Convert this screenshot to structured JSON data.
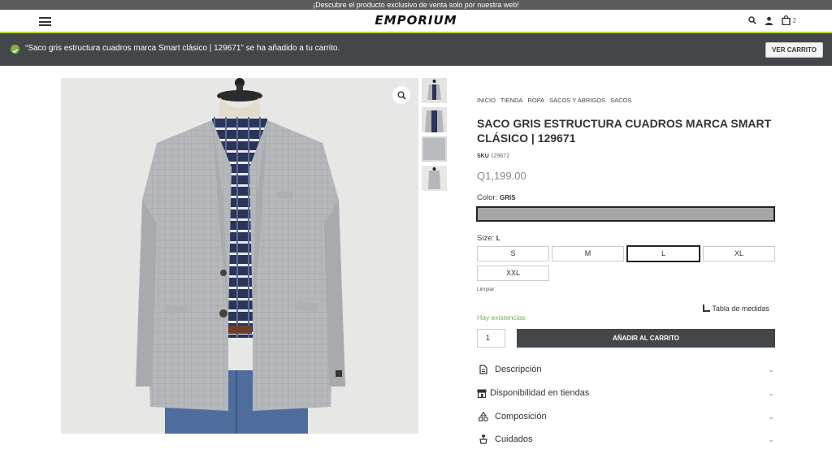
{
  "topbar": {
    "text": "¡Descubre el producto exclusivo de venta solo por nuestra web!"
  },
  "header": {
    "logo": "EMPORIUM",
    "cart_count": "2"
  },
  "notice": {
    "text": "“Saco gris estructura cuadros marca Smart clásico | 129671” se ha añadido a tu carrito.",
    "button": "VER CARRITO"
  },
  "breadcrumb": [
    "INICIO",
    "TIENDA",
    "ROPA",
    "SACOS Y ABRIGOS",
    "SACOS"
  ],
  "product": {
    "title": "SACO GRIS ESTRUCTURA CUADROS MARCA SMART CLÁSICO | 129671",
    "sku_label": "SKU",
    "sku": "129672",
    "price": "Q1,199.00",
    "color_label": "Color:",
    "color_value": "GRIS",
    "color_swatch": "#a6a6a6",
    "size_label": "Size:",
    "size_value": "L",
    "sizes": [
      "S",
      "M",
      "L",
      "XL",
      "XXL"
    ],
    "clear": "Limpiar",
    "stock": "Hay existencias",
    "size_chart": "Tabla de medidas",
    "quantity": "1",
    "add_to_cart": "AÑADIR AL CARRITO"
  },
  "accordion": [
    "Descripción",
    "Disponibilidad en tiendas",
    "Composición",
    "Cuidados"
  ],
  "colors": {
    "accent": "#b5d434",
    "notice_bg": "#44474a",
    "success": "#7cb342"
  }
}
